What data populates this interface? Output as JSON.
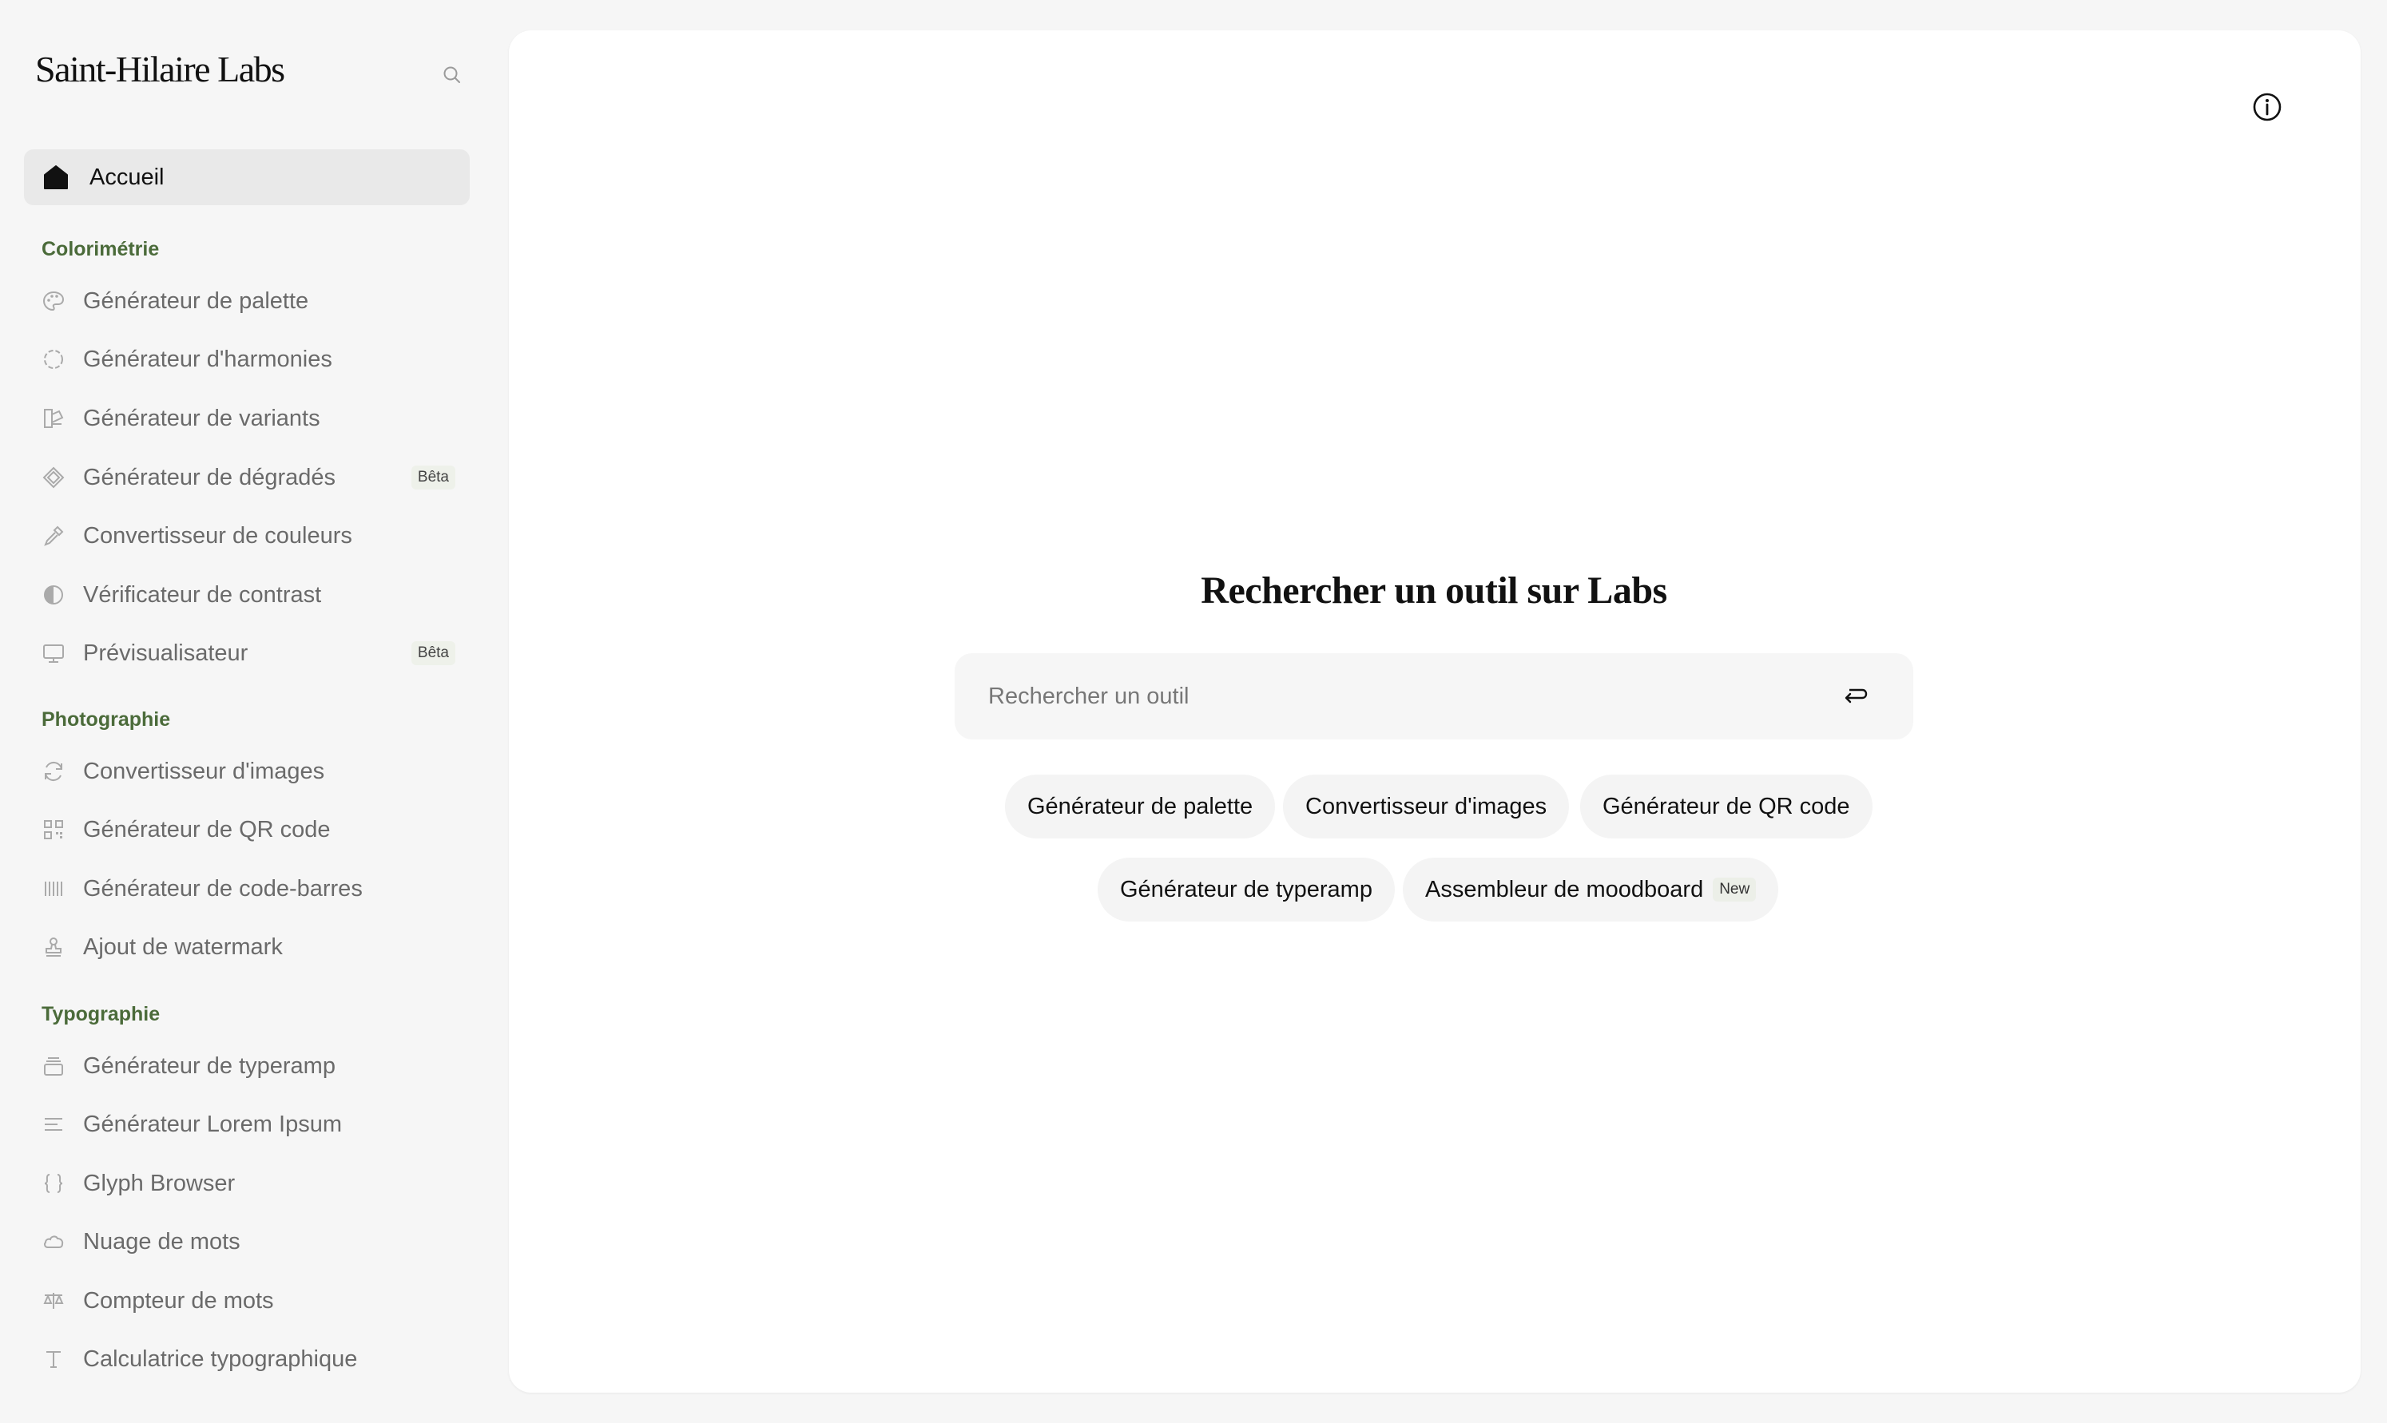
{
  "sidebar": {
    "brand": "Saint-Hilaire Labs",
    "search_icon": "search-icon",
    "home": {
      "label": "Accueil",
      "icon": "home-icon"
    },
    "sections": [
      {
        "title": "Colorimétrie",
        "items": [
          {
            "label": "Générateur de palette",
            "icon": "palette-icon"
          },
          {
            "label": "Générateur d'harmonies",
            "icon": "dashed-circle-icon"
          },
          {
            "label": "Générateur de variants",
            "icon": "variants-icon"
          },
          {
            "label": "Générateur de dégradés",
            "icon": "gradient-icon",
            "badge": "Bêta"
          },
          {
            "label": "Convertisseur de couleurs",
            "icon": "eyedropper-icon"
          },
          {
            "label": "Vérificateur de contrast",
            "icon": "contrast-icon"
          },
          {
            "label": "Prévisualisateur",
            "icon": "monitor-icon",
            "badge": "Bêta"
          }
        ]
      },
      {
        "title": "Photographie",
        "items": [
          {
            "label": "Convertisseur d'images",
            "icon": "refresh-icon"
          },
          {
            "label": "Générateur de QR code",
            "icon": "qr-code-icon"
          },
          {
            "label": "Générateur de code-barres",
            "icon": "barcode-icon"
          },
          {
            "label": "Ajout de watermark",
            "icon": "stamp-icon"
          }
        ]
      },
      {
        "title": "Typographie",
        "items": [
          {
            "label": "Générateur de typeramp",
            "icon": "stack-icon"
          },
          {
            "label": "Générateur Lorem Ipsum",
            "icon": "text-lines-icon"
          },
          {
            "label": "Glyph Browser",
            "icon": "braces-icon"
          },
          {
            "label": "Nuage de mots",
            "icon": "cloud-icon"
          },
          {
            "label": "Compteur de mots",
            "icon": "scale-icon"
          },
          {
            "label": "Calculatrice typographique",
            "icon": "type-icon"
          }
        ]
      }
    ]
  },
  "main": {
    "info_icon": "info-icon",
    "title": "Rechercher un outil sur Labs",
    "search": {
      "placeholder": "Rechercher un outil",
      "value": "",
      "enter_icon": "enter-icon"
    },
    "suggestions": [
      {
        "label": "Générateur de palette"
      },
      {
        "label": "Convertisseur d'images"
      },
      {
        "label": "Générateur de QR code"
      },
      {
        "label": "Générateur de typeramp"
      },
      {
        "label": "Assembleur de moodboard",
        "badge": "New"
      }
    ]
  },
  "colors": {
    "background": "#f6f6f6",
    "panel": "#ffffff",
    "section_title": "#4b6b3a",
    "nav_text": "#6a6a6a",
    "active_bg": "#e9e9e9"
  }
}
